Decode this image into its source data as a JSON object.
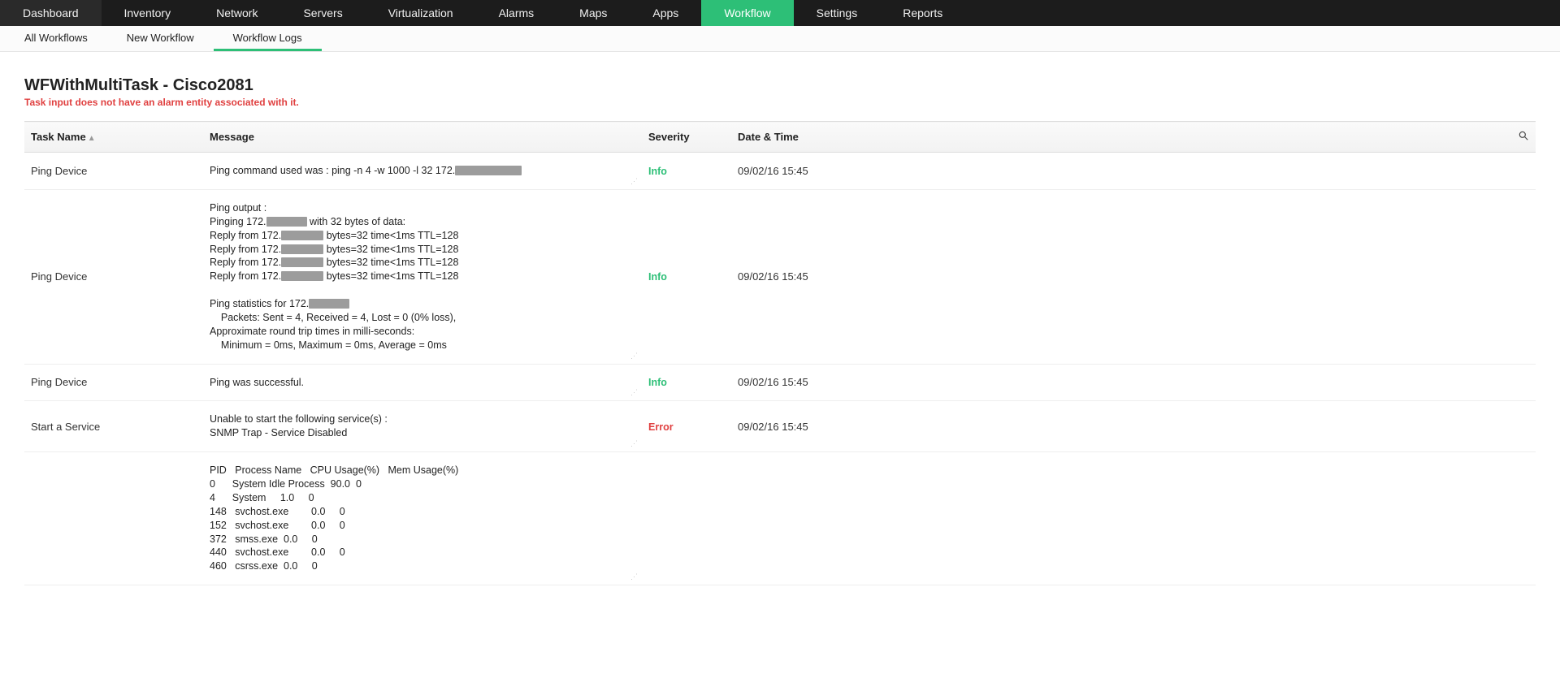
{
  "topnav": {
    "items": [
      "Dashboard",
      "Inventory",
      "Network",
      "Servers",
      "Virtualization",
      "Alarms",
      "Maps",
      "Apps",
      "Workflow",
      "Settings",
      "Reports"
    ],
    "active_index": 8
  },
  "subnav": {
    "items": [
      "All Workflows",
      "New Workflow",
      "Workflow Logs"
    ],
    "active_index": 2
  },
  "page_title": "WFWithMultiTask - Cisco2081",
  "page_error": "Task input does not have an alarm entity associated with it.",
  "columns": {
    "task": "Task Name",
    "message": "Message",
    "severity": "Severity",
    "datetime": "Date & Time"
  },
  "rows": [
    {
      "task": "Ping Device",
      "message_segments": [
        {
          "t": "Ping command used was : ping -n 4 -w 1000 -l 32 172."
        },
        {
          "r": 82
        }
      ],
      "severity": "Info",
      "severity_class": "info",
      "datetime": "09/02/16 15:45"
    },
    {
      "task": "Ping Device",
      "message_segments": [
        {
          "t": "Ping output :\nPinging 172."
        },
        {
          "r": 50
        },
        {
          "t": " with 32 bytes of data:\nReply from 172."
        },
        {
          "r": 52
        },
        {
          "t": " bytes=32 time<1ms TTL=128\nReply from 172."
        },
        {
          "r": 52
        },
        {
          "t": " bytes=32 time<1ms TTL=128\nReply from 172."
        },
        {
          "r": 52
        },
        {
          "t": " bytes=32 time<1ms TTL=128\nReply from 172."
        },
        {
          "r": 52
        },
        {
          "t": " bytes=32 time<1ms TTL=128\n\nPing statistics for 172."
        },
        {
          "r": 50
        },
        {
          "t": "\n    Packets: Sent = 4, Received = 4, Lost = 0 (0% loss),\nApproximate round trip times in milli-seconds:\n    Minimum = 0ms, Maximum = 0ms, Average = 0ms"
        }
      ],
      "severity": "Info",
      "severity_class": "info",
      "datetime": "09/02/16 15:45"
    },
    {
      "task": "Ping Device",
      "message_segments": [
        {
          "t": "Ping was successful."
        }
      ],
      "severity": "Info",
      "severity_class": "info",
      "datetime": "09/02/16 15:45"
    },
    {
      "task": "Start a Service",
      "message_segments": [
        {
          "t": "Unable to start the following service(s) :\nSNMP Trap - Service Disabled"
        }
      ],
      "severity": "Error",
      "severity_class": "error",
      "datetime": "09/02/16 15:45"
    },
    {
      "task": "",
      "message_segments": [
        {
          "t": "PID   Process Name   CPU Usage(%)   Mem Usage(%)\n0      System Idle Process  90.0  0\n4      System     1.0     0\n148   svchost.exe        0.0     0\n152   svchost.exe        0.0     0\n372   smss.exe  0.0     0\n440   svchost.exe        0.0     0\n460   csrss.exe  0.0     0"
        }
      ],
      "severity": "",
      "severity_class": "",
      "datetime": ""
    }
  ]
}
